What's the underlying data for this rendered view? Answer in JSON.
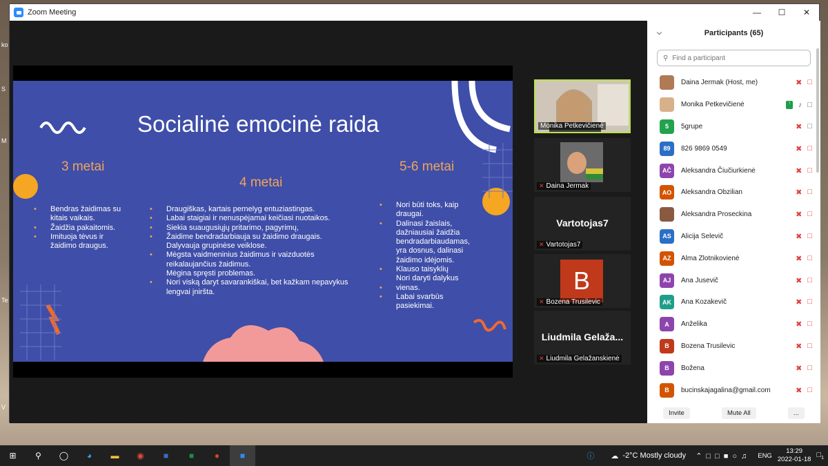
{
  "window": {
    "title": "Zoom Meeting"
  },
  "desktop_labels": [
    "ko",
    "S",
    "M",
    "Te",
    "V"
  ],
  "slide": {
    "title": "Socialinė emocinė raida",
    "columns": [
      {
        "heading": "3 metai",
        "items": [
          {
            "text": "Bendras žaidimas su",
            "bullet": true
          },
          {
            "text": "kitais vaikais.",
            "bullet": false
          },
          {
            "text": "Žaidžia pakaitomis.",
            "bullet": true
          },
          {
            "text": "Imituoja tėvus ir",
            "bullet": true
          },
          {
            "text": "žaidimo draugus.",
            "bullet": false
          }
        ]
      },
      {
        "heading": "4 metai",
        "items": [
          {
            "text": "Draugiškas, kartais pernelyg entuziastingas.",
            "bullet": true
          },
          {
            "text": "Labai staigiai ir nenuspėjamai keičiasi nuotaikos.",
            "bullet": true
          },
          {
            "text": "Siekia suaugusiųjų pritarimo, pagyrimų,",
            "bullet": true
          },
          {
            "text": "Žaidime bendradarbiauja su žaidimo draugais.",
            "bullet": true
          },
          {
            "text": "Dalyvauja grupinėse veiklose.",
            "bullet": false
          },
          {
            "text": "Mėgsta vaidmeninius žaidimus ir vaizduotės",
            "bullet": true
          },
          {
            "text": "reikalaujančius žaidimus.",
            "bullet": false
          },
          {
            "text": "Mėgina spręsti problemas.",
            "bullet": false
          },
          {
            "text": "Nori viską daryt savarankiškai, bet kažkam nepavykus",
            "bullet": true
          },
          {
            "text": "lengvai įniršta.",
            "bullet": false
          }
        ]
      },
      {
        "heading": "5-6 metai",
        "items": [
          {
            "text": "Nori būti toks, kaip",
            "bullet": true
          },
          {
            "text": "draugai.",
            "bullet": false
          },
          {
            "text": "Dalinasi žaislais,",
            "bullet": true
          },
          {
            "text": "dažniausiai žaidžia",
            "bullet": false
          },
          {
            "text": "bendradarbiaudamas,",
            "bullet": false
          },
          {
            "text": "yra dosnus, dalinasi",
            "bullet": false
          },
          {
            "text": "žaidimo idėjomis.",
            "bullet": false
          },
          {
            "text": "Klauso taisyklių",
            "bullet": true
          },
          {
            "text": "Nori daryti dalykus",
            "bullet": false
          },
          {
            "text": "vienas.",
            "bullet": true
          },
          {
            "text": "Labai svarbūs",
            "bullet": true
          },
          {
            "text": "pasiekimai.",
            "bullet": false
          }
        ]
      }
    ]
  },
  "thumbnails": [
    {
      "name": "Monika Petkevičienė",
      "muted": false,
      "active": true,
      "big": ""
    },
    {
      "name": "Daina Jermak",
      "muted": true,
      "active": false,
      "big": ""
    },
    {
      "name": "Vartotojas7",
      "muted": true,
      "active": false,
      "big": "Vartotojas7"
    },
    {
      "name": "Bozena Trusilevic",
      "muted": true,
      "active": false,
      "big": "B"
    },
    {
      "name": "Liudmila Gelažanskienė",
      "muted": true,
      "active": false,
      "big": "Liudmila Gelaža..."
    }
  ],
  "participants_panel": {
    "header": "Participants (65)",
    "search_placeholder": "Find a participant",
    "invite": "Invite",
    "mute_all": "Mute All",
    "more": "...",
    "rows": [
      {
        "initials": "",
        "color": "#b07a55",
        "name": "Daina Jermak (Host, me)",
        "photo": true,
        "mic": "off",
        "cam": "off"
      },
      {
        "initials": "",
        "color": "#d8b08a",
        "name": "Monika Petkevičienė",
        "photo": true,
        "mic": "on",
        "cam": "on",
        "share": true
      },
      {
        "initials": "5",
        "color": "#23a24d",
        "name": "5grupe",
        "mic": "off",
        "cam": "on"
      },
      {
        "initials": "89",
        "color": "#2a6fc7",
        "name": "826 9869 0549",
        "mic": "off",
        "cam": "off"
      },
      {
        "initials": "AČ",
        "color": "#8e44ad",
        "name": "Aleksandra Čiučiurkienė",
        "mic": "off",
        "cam": "off"
      },
      {
        "initials": "AO",
        "color": "#d35400",
        "name": "Aleksandra Obzilian",
        "mic": "off",
        "cam": "off"
      },
      {
        "initials": "",
        "color": "#8a5a40",
        "name": "Aleksandra Proseckina",
        "photo": true,
        "mic": "off",
        "cam": "off"
      },
      {
        "initials": "AS",
        "color": "#2a6fc7",
        "name": "Alicija Selevič",
        "mic": "off",
        "cam": "off"
      },
      {
        "initials": "AZ",
        "color": "#d35400",
        "name": "Alma Zlotnikovienė",
        "mic": "off",
        "cam": "off"
      },
      {
        "initials": "AJ",
        "color": "#8e44ad",
        "name": "Ana Jusevič",
        "mic": "off",
        "cam": "off"
      },
      {
        "initials": "AK",
        "color": "#1f9e8a",
        "name": "Ana Kozakevič",
        "mic": "off",
        "cam": "off"
      },
      {
        "initials": "A",
        "color": "#8e44ad",
        "name": "Anželika",
        "mic": "off",
        "cam": "off"
      },
      {
        "initials": "B",
        "color": "#c0391b",
        "name": "Bozena Trusilevic",
        "mic": "off",
        "cam": "off"
      },
      {
        "initials": "B",
        "color": "#8e44ad",
        "name": "Božena",
        "mic": "off",
        "cam": "off"
      },
      {
        "initials": "B",
        "color": "#d35400",
        "name": "bucinskajagalina@gmail.com",
        "mic": "off",
        "cam": "off"
      }
    ]
  },
  "taskbar": {
    "weather": "-2°C  Mostly cloudy",
    "lang": "ENG",
    "time": "13:29",
    "date": "2022-01-18",
    "notif_count": "1"
  }
}
